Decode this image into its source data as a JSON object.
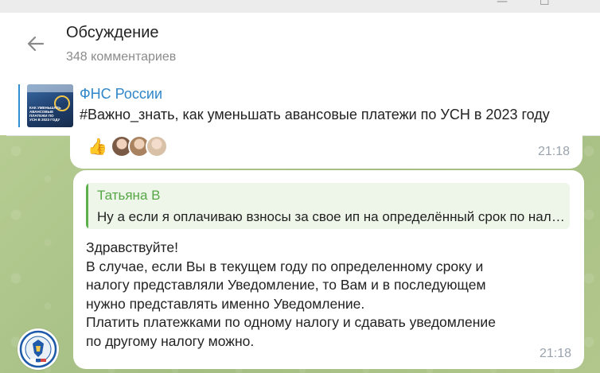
{
  "window": {
    "minimize_glyph": "—",
    "maximize_glyph": "☐"
  },
  "header": {
    "title": "Обсуждение",
    "subtitle": "348 комментариев",
    "back_icon": "arrow-left-icon"
  },
  "pinned": {
    "channel": "ФНС России",
    "text": "#Важно_знать, как уменьшать авансовые платежи по УСН в 2023 году",
    "thumbnail_text": "Как уменьшать авансовые платежи по УСН в 2023 году",
    "accent_color": "#2f86c8"
  },
  "messages": [
    {
      "reactions": {
        "emoji": "👍",
        "avatars": [
          "avatar-1",
          "avatar-2",
          "avatar-3"
        ]
      },
      "time": "21:18"
    },
    {
      "reply": {
        "author": "Татьяна В",
        "text": "Ну а если я оплачиваю взносы за свое ип на определённый срок по налогу"
      },
      "lines": [
        "Здравствуйте!",
        "В случае, если Вы в текущем году по определенному сроку и",
        "налогу представляли Уведомление, то Вам и в последующем",
        "нужно представлять именно Уведомление.",
        "Платить платежками по одному налогу и сдавать уведомление",
        "по другому налогу можно."
      ],
      "time": "21:18",
      "sender_avatar": "fns-emblem-icon"
    }
  ],
  "colors": {
    "wallpaper": "#a9c18a",
    "reply_name": "#56a646",
    "time": "#9aa3ad"
  }
}
